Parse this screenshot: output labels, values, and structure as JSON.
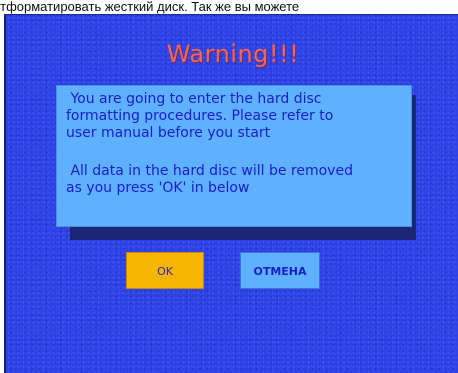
{
  "top_caption": "Отформатировать жесткий диск. Так же вы можете",
  "dialog": {
    "title": "Warning!!!",
    "message_1": " You are going to enter the hard disc\nformatting procedures. Please refer to\nuser manual before you start",
    "message_2": " All data in the hard disc will be removed\nas you press 'OK' in below"
  },
  "buttons": {
    "ok_label": "OK",
    "cancel_label": "ОТМЕНА"
  },
  "colors": {
    "background": "#2a3fe6",
    "title": "#f0645a",
    "message_box": "#5fb0ff",
    "message_text": "#1a1ec8",
    "ok_button": "#f7b400"
  }
}
